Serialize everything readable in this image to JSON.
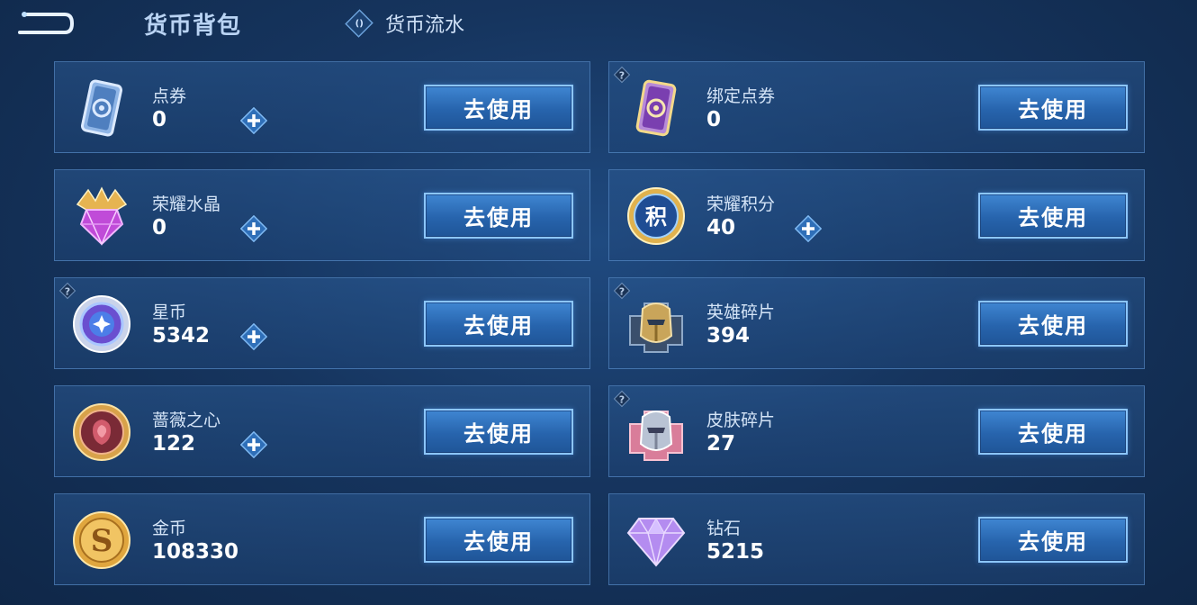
{
  "header": {
    "title": "货币背包",
    "flow_label": "货币流水",
    "flow_icon_glyph": "()"
  },
  "use_label": "去使用",
  "currencies": [
    {
      "name": "点券",
      "value": "0",
      "icon": "ticket-icon"
    },
    {
      "name": "绑定点券",
      "value": "0",
      "icon": "bound-ticket-icon"
    },
    {
      "name": "荣耀水晶",
      "value": "0",
      "icon": "glory-crystal-icon"
    },
    {
      "name": "荣耀积分",
      "value": "40",
      "icon": "glory-points-icon"
    },
    {
      "name": "星币",
      "value": "5342",
      "icon": "star-coin-icon"
    },
    {
      "name": "英雄碎片",
      "value": "394",
      "icon": "hero-shard-icon"
    },
    {
      "name": "蔷薇之心",
      "value": "122",
      "icon": "rose-heart-icon"
    },
    {
      "name": "皮肤碎片",
      "value": "27",
      "icon": "skin-shard-icon"
    },
    {
      "name": "金币",
      "value": "108330",
      "icon": "gold-coin-icon"
    },
    {
      "name": "钻石",
      "value": "5215",
      "icon": "diamond-icon"
    }
  ],
  "glyphs": {
    "points_badge": "积",
    "gold_badge": "S",
    "help": "?"
  },
  "colors": {
    "button_blue": "#2764ad",
    "button_border": "#8cc6ff",
    "card_border": "#6096d2"
  }
}
